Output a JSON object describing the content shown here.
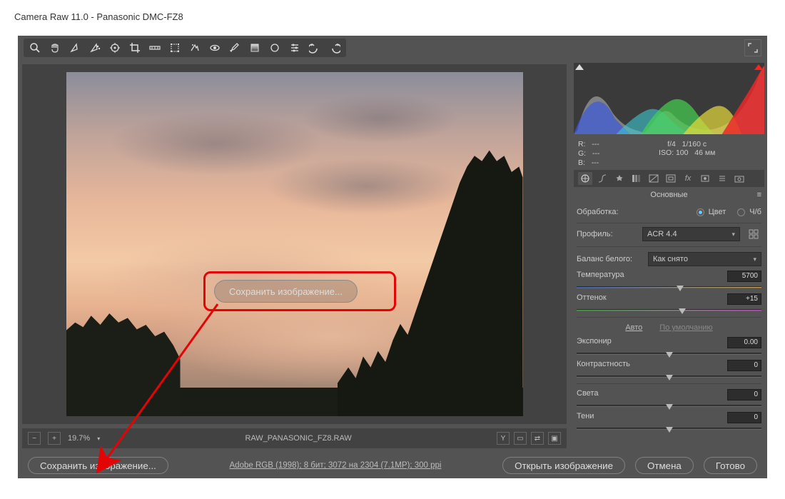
{
  "titlebar": "Camera Raw 11.0  -  Panasonic DMC-FZ8",
  "toolbar_icons": [
    "zoom",
    "hand",
    "white-balance",
    "color-sampler",
    "target-adjust",
    "crop",
    "straighten",
    "transform",
    "spot-removal",
    "redeye",
    "brush",
    "grad-filter",
    "radial-filter",
    "options",
    "rotate-ccw",
    "rotate-cw"
  ],
  "fullscreen_icon": "⤢",
  "histogram": {
    "shadow_clip": "white",
    "highlight_clip": "red"
  },
  "readout": {
    "rgb": {
      "R": "---",
      "G": "---",
      "B": "---"
    },
    "aperture": "f/4",
    "shutter": "1/160 c",
    "iso_label": "ISO:",
    "iso": "100",
    "focal": "46 мм"
  },
  "preview_status": {
    "zoom": "19.7%",
    "filename": "RAW_PANASONIC_FZ8.RAW"
  },
  "panel": {
    "title": "Основные",
    "treatment": {
      "label": "Обработка:",
      "opt_color": "Цвет",
      "opt_bw": "Ч/б"
    },
    "profile": {
      "label": "Профиль:",
      "value": "ACR 4.4"
    },
    "wb": {
      "label": "Баланс белого:",
      "value": "Как снято"
    },
    "temperature": {
      "label": "Температура",
      "value": "5700",
      "pos": 56
    },
    "tint": {
      "label": "Оттенок",
      "value": "+15",
      "pos": 57
    },
    "auto": "Авто",
    "default": "По умолчанию",
    "exposure": {
      "label": "Экспонир",
      "value": "0.00",
      "pos": 50
    },
    "contrast": {
      "label": "Контрастность",
      "value": "0",
      "pos": 50
    },
    "highlights": {
      "label": "Света",
      "value": "0",
      "pos": 50
    },
    "shadows": {
      "label": "Тени",
      "value": "0",
      "pos": 50
    }
  },
  "bottom": {
    "save": "Сохранить изображение...",
    "info": "Adobe RGB (1998); 8 бит; 3072 на 2304 (7.1MP); 300 ppi",
    "open": "Открыть изображение",
    "cancel": "Отмена",
    "done": "Готово"
  },
  "callout": "Сохранить изображение..."
}
